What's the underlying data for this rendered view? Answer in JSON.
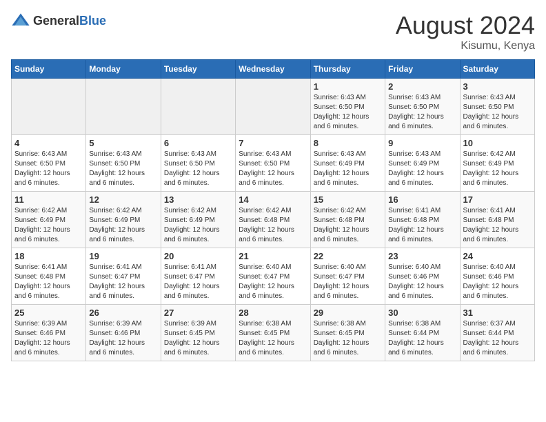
{
  "header": {
    "logo_general": "General",
    "logo_blue": "Blue",
    "month_year": "August 2024",
    "location": "Kisumu, Kenya"
  },
  "days_of_week": [
    "Sunday",
    "Monday",
    "Tuesday",
    "Wednesday",
    "Thursday",
    "Friday",
    "Saturday"
  ],
  "weeks": [
    [
      {
        "day": "",
        "sunrise": "",
        "sunset": "",
        "daylight": "",
        "empty": true
      },
      {
        "day": "",
        "sunrise": "",
        "sunset": "",
        "daylight": "",
        "empty": true
      },
      {
        "day": "",
        "sunrise": "",
        "sunset": "",
        "daylight": "",
        "empty": true
      },
      {
        "day": "",
        "sunrise": "",
        "sunset": "",
        "daylight": "",
        "empty": true
      },
      {
        "day": "1",
        "sunrise": "Sunrise: 6:43 AM",
        "sunset": "Sunset: 6:50 PM",
        "daylight": "Daylight: 12 hours and 6 minutes."
      },
      {
        "day": "2",
        "sunrise": "Sunrise: 6:43 AM",
        "sunset": "Sunset: 6:50 PM",
        "daylight": "Daylight: 12 hours and 6 minutes."
      },
      {
        "day": "3",
        "sunrise": "Sunrise: 6:43 AM",
        "sunset": "Sunset: 6:50 PM",
        "daylight": "Daylight: 12 hours and 6 minutes."
      }
    ],
    [
      {
        "day": "4",
        "sunrise": "Sunrise: 6:43 AM",
        "sunset": "Sunset: 6:50 PM",
        "daylight": "Daylight: 12 hours and 6 minutes."
      },
      {
        "day": "5",
        "sunrise": "Sunrise: 6:43 AM",
        "sunset": "Sunset: 6:50 PM",
        "daylight": "Daylight: 12 hours and 6 minutes."
      },
      {
        "day": "6",
        "sunrise": "Sunrise: 6:43 AM",
        "sunset": "Sunset: 6:50 PM",
        "daylight": "Daylight: 12 hours and 6 minutes."
      },
      {
        "day": "7",
        "sunrise": "Sunrise: 6:43 AM",
        "sunset": "Sunset: 6:50 PM",
        "daylight": "Daylight: 12 hours and 6 minutes."
      },
      {
        "day": "8",
        "sunrise": "Sunrise: 6:43 AM",
        "sunset": "Sunset: 6:49 PM",
        "daylight": "Daylight: 12 hours and 6 minutes."
      },
      {
        "day": "9",
        "sunrise": "Sunrise: 6:43 AM",
        "sunset": "Sunset: 6:49 PM",
        "daylight": "Daylight: 12 hours and 6 minutes."
      },
      {
        "day": "10",
        "sunrise": "Sunrise: 6:42 AM",
        "sunset": "Sunset: 6:49 PM",
        "daylight": "Daylight: 12 hours and 6 minutes."
      }
    ],
    [
      {
        "day": "11",
        "sunrise": "Sunrise: 6:42 AM",
        "sunset": "Sunset: 6:49 PM",
        "daylight": "Daylight: 12 hours and 6 minutes."
      },
      {
        "day": "12",
        "sunrise": "Sunrise: 6:42 AM",
        "sunset": "Sunset: 6:49 PM",
        "daylight": "Daylight: 12 hours and 6 minutes."
      },
      {
        "day": "13",
        "sunrise": "Sunrise: 6:42 AM",
        "sunset": "Sunset: 6:49 PM",
        "daylight": "Daylight: 12 hours and 6 minutes."
      },
      {
        "day": "14",
        "sunrise": "Sunrise: 6:42 AM",
        "sunset": "Sunset: 6:48 PM",
        "daylight": "Daylight: 12 hours and 6 minutes."
      },
      {
        "day": "15",
        "sunrise": "Sunrise: 6:42 AM",
        "sunset": "Sunset: 6:48 PM",
        "daylight": "Daylight: 12 hours and 6 minutes."
      },
      {
        "day": "16",
        "sunrise": "Sunrise: 6:41 AM",
        "sunset": "Sunset: 6:48 PM",
        "daylight": "Daylight: 12 hours and 6 minutes."
      },
      {
        "day": "17",
        "sunrise": "Sunrise: 6:41 AM",
        "sunset": "Sunset: 6:48 PM",
        "daylight": "Daylight: 12 hours and 6 minutes."
      }
    ],
    [
      {
        "day": "18",
        "sunrise": "Sunrise: 6:41 AM",
        "sunset": "Sunset: 6:48 PM",
        "daylight": "Daylight: 12 hours and 6 minutes."
      },
      {
        "day": "19",
        "sunrise": "Sunrise: 6:41 AM",
        "sunset": "Sunset: 6:47 PM",
        "daylight": "Daylight: 12 hours and 6 minutes."
      },
      {
        "day": "20",
        "sunrise": "Sunrise: 6:41 AM",
        "sunset": "Sunset: 6:47 PM",
        "daylight": "Daylight: 12 hours and 6 minutes."
      },
      {
        "day": "21",
        "sunrise": "Sunrise: 6:40 AM",
        "sunset": "Sunset: 6:47 PM",
        "daylight": "Daylight: 12 hours and 6 minutes."
      },
      {
        "day": "22",
        "sunrise": "Sunrise: 6:40 AM",
        "sunset": "Sunset: 6:47 PM",
        "daylight": "Daylight: 12 hours and 6 minutes."
      },
      {
        "day": "23",
        "sunrise": "Sunrise: 6:40 AM",
        "sunset": "Sunset: 6:46 PM",
        "daylight": "Daylight: 12 hours and 6 minutes."
      },
      {
        "day": "24",
        "sunrise": "Sunrise: 6:40 AM",
        "sunset": "Sunset: 6:46 PM",
        "daylight": "Daylight: 12 hours and 6 minutes."
      }
    ],
    [
      {
        "day": "25",
        "sunrise": "Sunrise: 6:39 AM",
        "sunset": "Sunset: 6:46 PM",
        "daylight": "Daylight: 12 hours and 6 minutes."
      },
      {
        "day": "26",
        "sunrise": "Sunrise: 6:39 AM",
        "sunset": "Sunset: 6:46 PM",
        "daylight": "Daylight: 12 hours and 6 minutes."
      },
      {
        "day": "27",
        "sunrise": "Sunrise: 6:39 AM",
        "sunset": "Sunset: 6:45 PM",
        "daylight": "Daylight: 12 hours and 6 minutes."
      },
      {
        "day": "28",
        "sunrise": "Sunrise: 6:38 AM",
        "sunset": "Sunset: 6:45 PM",
        "daylight": "Daylight: 12 hours and 6 minutes."
      },
      {
        "day": "29",
        "sunrise": "Sunrise: 6:38 AM",
        "sunset": "Sunset: 6:45 PM",
        "daylight": "Daylight: 12 hours and 6 minutes."
      },
      {
        "day": "30",
        "sunrise": "Sunrise: 6:38 AM",
        "sunset": "Sunset: 6:44 PM",
        "daylight": "Daylight: 12 hours and 6 minutes."
      },
      {
        "day": "31",
        "sunrise": "Sunrise: 6:37 AM",
        "sunset": "Sunset: 6:44 PM",
        "daylight": "Daylight: 12 hours and 6 minutes."
      }
    ]
  ]
}
